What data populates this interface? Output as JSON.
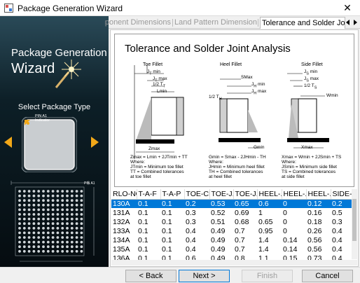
{
  "window": {
    "title": "Package Generation Wizard",
    "close_glyph": "✕"
  },
  "left_panel": {
    "title_line1": "Package Generation",
    "title_line2": "Wizard",
    "select_label": "Select Package Type",
    "pin_label_line1": "PIN A1",
    "pin_label_line2": "Indicator",
    "bga_pin_label": "PIN A1",
    "colors": {
      "arrow": "#f2a818"
    }
  },
  "tabs": [
    {
      "label": "Component Dimensions",
      "active": false
    },
    {
      "label": "Land Pattern Dimensions",
      "active": false
    },
    {
      "label": "Tolerance and Solder Joint Analysis",
      "active": true
    }
  ],
  "diagram": {
    "title": "Tolerance and Solder Joint Analysis",
    "toe": {
      "label": "Toe Fillet",
      "j_min": "J",
      "j_min_sub": "T",
      "j_min_text": " min",
      "j_max_text": " max",
      "half_t": "1/2 T",
      "half_t_sub": "T",
      "lmin": "Lmin",
      "zmax": "Zmax",
      "formula": "Zmax = Lmin + 2JTmin + TT\nWhere:\nJTmin = Minimum toe fillet\nTT = Combined tolerances\nat toe fillet"
    },
    "heel": {
      "label": "Heel Fillet",
      "smax": "SMax",
      "j_text": "J",
      "j_sub": "H",
      "min_text": " min",
      "max_text": " max",
      "half_t": "1/2 T",
      "half_t_sub": "H",
      "gmin": "Gmin",
      "formula": "Gmin = Smax - 2JHmin - TH\nWhere:\nJHmin = Minimum heel fillet\nTH = Combined tolerances\nat heel fillet"
    },
    "side": {
      "label": "Side Fillet",
      "j_text": "J",
      "j_sub": "S",
      "min_text": " min",
      "max_text": " max",
      "half_t": "1/2 T",
      "half_t_sub": "S",
      "wmin": "Wmin",
      "xmax": "Xmax",
      "formula": "Xmax = Wmin + 2JSmin + TS\nWhere:\nJSmin = Minimum side fillet\nTS = Combined tolerances\nat side fillet"
    }
  },
  "table": {
    "columns": [
      "RLO-NO",
      "T-A-F",
      "T-A-P",
      "TOE-CL",
      "TOE-J...",
      "TOE-J...",
      "HEEL-...",
      "HEEL-...",
      "HEEL-...",
      "SIDE-..."
    ],
    "selected_row": 0,
    "rows": [
      [
        "130A",
        "0.1",
        "0.1",
        "0.2",
        "0.53",
        "0.65",
        "0.6",
        "0",
        "0.12",
        "0.2"
      ],
      [
        "131A",
        "0.1",
        "0.1",
        "0.3",
        "0.52",
        "0.69",
        "1",
        "0",
        "0.16",
        "0.5"
      ],
      [
        "132A",
        "0.1",
        "0.1",
        "0.3",
        "0.51",
        "0.68",
        "0.65",
        "0",
        "0.18",
        "0.3"
      ],
      [
        "133A",
        "0.1",
        "0.1",
        "0.4",
        "0.49",
        "0.7",
        "0.95",
        "0",
        "0.26",
        "0.4"
      ],
      [
        "134A",
        "0.1",
        "0.1",
        "0.4",
        "0.49",
        "0.7",
        "1.4",
        "0.14",
        "0.56",
        "0.4"
      ],
      [
        "135A",
        "0.1",
        "0.1",
        "0.4",
        "0.49",
        "0.7",
        "1.4",
        "0.14",
        "0.56",
        "0.4"
      ],
      [
        "136A",
        "0.1",
        "0.1",
        "0.6",
        "0.49",
        "0.8",
        "1.1",
        "0.15",
        "0.73",
        "0.4"
      ]
    ]
  },
  "buttons": {
    "back": "< Back",
    "next": "Next >",
    "finish": "Finish",
    "cancel": "Cancel"
  }
}
